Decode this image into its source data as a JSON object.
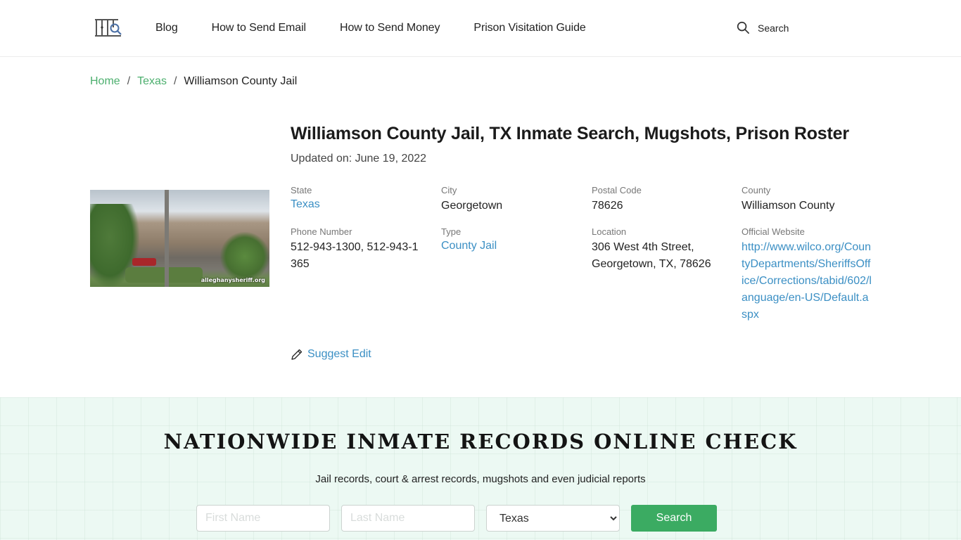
{
  "header": {
    "logo_icon": "jail-bars-magnifier-icon",
    "nav": [
      {
        "label": "Blog"
      },
      {
        "label": "How to Send Email"
      },
      {
        "label": "How to Send Money"
      },
      {
        "label": "Prison Visitation Guide"
      }
    ],
    "search_label": "Search",
    "search_icon": "search-icon"
  },
  "breadcrumb": {
    "items": [
      {
        "label": "Home",
        "link": true
      },
      {
        "label": "Texas",
        "link": true
      },
      {
        "label": "Williamson County Jail",
        "link": false
      }
    ],
    "separator": "/"
  },
  "facility": {
    "title": "Williamson County Jail, TX Inmate Search, Mugshots, Prison Roster",
    "updated": "Updated on: June 19, 2022",
    "image_watermark": "alleghanysheriff.org",
    "fields": [
      {
        "label": "State",
        "value": "Texas",
        "link": true
      },
      {
        "label": "City",
        "value": "Georgetown",
        "link": false
      },
      {
        "label": "Postal Code",
        "value": "78626",
        "link": false
      },
      {
        "label": "County",
        "value": "Williamson County",
        "link": false
      },
      {
        "label": "Phone Number",
        "value": "512-943-1300, 512-943-1365",
        "link": false
      },
      {
        "label": "Type",
        "value": "County Jail",
        "link": true
      },
      {
        "label": "Location",
        "value": "306 West 4th Street, Georgetown, TX, 78626",
        "link": false
      },
      {
        "label": "Official Website",
        "value": "http://www.wilco.org/CountyDepartments/SheriffsOffice/Corrections/tabid/602/language/en-US/Default.aspx",
        "link": true
      }
    ],
    "suggest_edit": "Suggest Edit"
  },
  "records": {
    "title": "NATIONWIDE INMATE RECORDS ONLINE CHECK",
    "subtitle": "Jail records, court & arrest records, mugshots and even judicial reports",
    "first_name_placeholder": "First Name",
    "last_name_placeholder": "Last Name",
    "state_selected": "Texas",
    "search_button": "Search"
  },
  "colors": {
    "brand_green": "#3bab62",
    "breadcrumb_link": "#4caf6e",
    "link_blue": "#3b8fc4",
    "section_bg": "#ecf9f3"
  }
}
